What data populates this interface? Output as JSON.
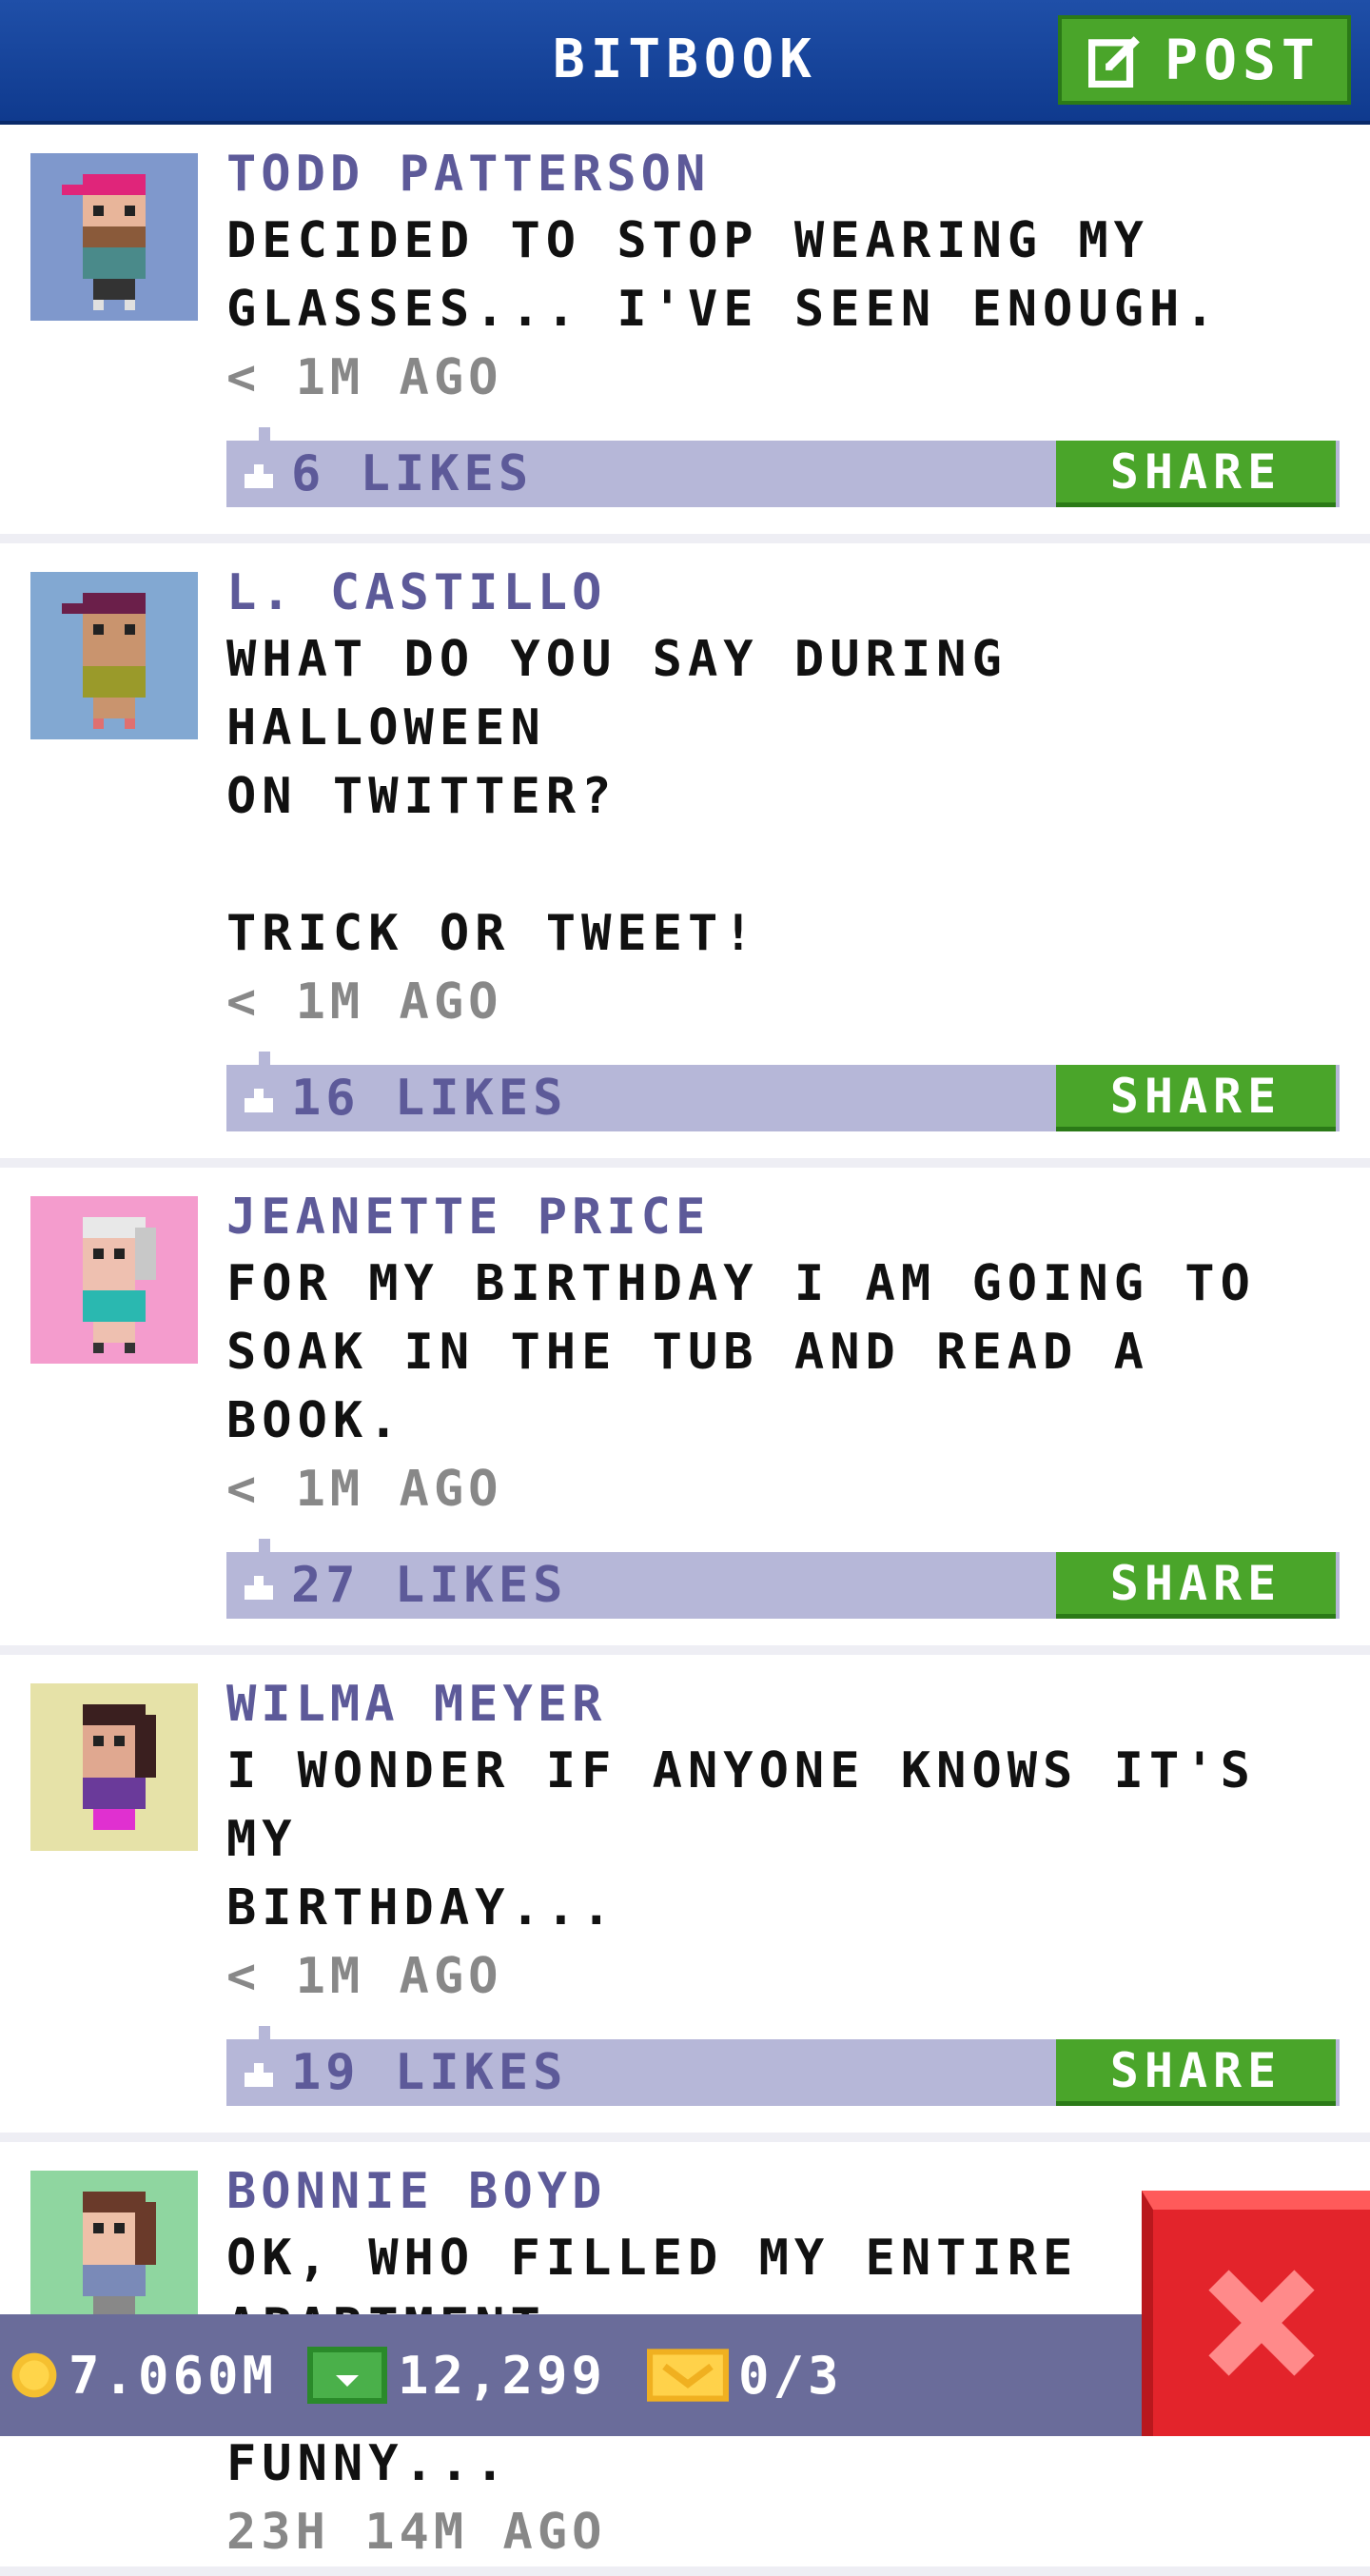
{
  "header": {
    "title": "BITBOOK",
    "post_label": "POST"
  },
  "posts": [
    {
      "author": "TODD PATTERSON",
      "message": "DECIDED TO STOP WEARING MY\nGLASSES... I'VE SEEN ENOUGH.",
      "time": "< 1M AGO",
      "likes": "6 LIKES",
      "share_label": "SHARE",
      "avatar_bg": "#7f98cc"
    },
    {
      "author": "L. CASTILLO",
      "message": "WHAT DO YOU SAY DURING HALLOWEEN\nON TWITTER?\n\nTRICK OR TWEET!",
      "time": "< 1M AGO",
      "likes": "16 LIKES",
      "share_label": "SHARE",
      "avatar_bg": "#82a8d2"
    },
    {
      "author": "JEANETTE PRICE",
      "message": "FOR MY BIRTHDAY I AM GOING TO\nSOAK IN THE TUB AND READ A BOOK.",
      "time": "< 1M AGO",
      "likes": "27 LIKES",
      "share_label": "SHARE",
      "avatar_bg": "#f49ccd"
    },
    {
      "author": "WILMA MEYER",
      "message": "I WONDER IF ANYONE KNOWS IT'S MY\nBIRTHDAY...",
      "time": "< 1M AGO",
      "likes": "19 LIKES",
      "share_label": "SHARE",
      "avatar_bg": "#e6e2a8"
    },
    {
      "author": "BONNIE BOYD",
      "message": "OK, WHO FILLED MY ENTIRE APARTMENT\nWITH PACKING PEANUTS? VERY\nFUNNY...",
      "time": "23H 14M AGO",
      "likes": "",
      "share_label": "",
      "avatar_bg": "#8fd6a0"
    }
  ],
  "bottom_bar": {
    "coins": "7.060M",
    "bux": "12,299",
    "tickets": "0/3"
  },
  "icons": [
    "edit-icon",
    "thumb-up-icon",
    "coin-icon",
    "bux-icon",
    "ticket-icon",
    "close-icon"
  ]
}
